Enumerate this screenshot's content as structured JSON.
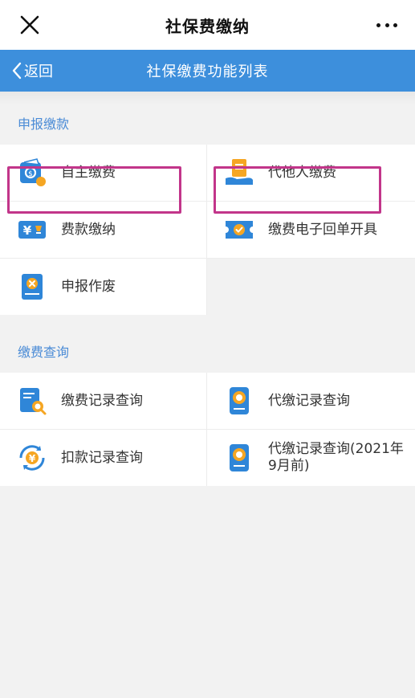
{
  "window": {
    "title": "社保费缴纳"
  },
  "nav": {
    "back_label": "返回",
    "title": "社保缴费功能列表"
  },
  "sections": [
    {
      "title": "申报缴款",
      "items": [
        {
          "label": "自主缴费",
          "icon": "wallet-icon",
          "highlighted": true
        },
        {
          "label": "代他人缴费",
          "icon": "document-hand-icon",
          "highlighted": true
        },
        {
          "label": "费款缴纳",
          "icon": "yuan-card-icon"
        },
        {
          "label": "缴费电子回单开具",
          "icon": "receipt-check-icon"
        },
        {
          "label": "申报作废",
          "icon": "cancel-doc-icon"
        }
      ]
    },
    {
      "title": "缴费查询",
      "items": [
        {
          "label": "缴费记录查询",
          "icon": "record-search-icon"
        },
        {
          "label": "代缴记录查询",
          "icon": "seal-record-icon"
        },
        {
          "label": "扣款记录查询",
          "icon": "yuan-cycle-icon"
        },
        {
          "label": "代缴记录查询(2021年9月前)",
          "icon": "seal-record-icon"
        }
      ]
    }
  ],
  "colors": {
    "accent": "#3d8fdc",
    "section_title": "#4a8bd6",
    "highlight": "#c2358a"
  }
}
